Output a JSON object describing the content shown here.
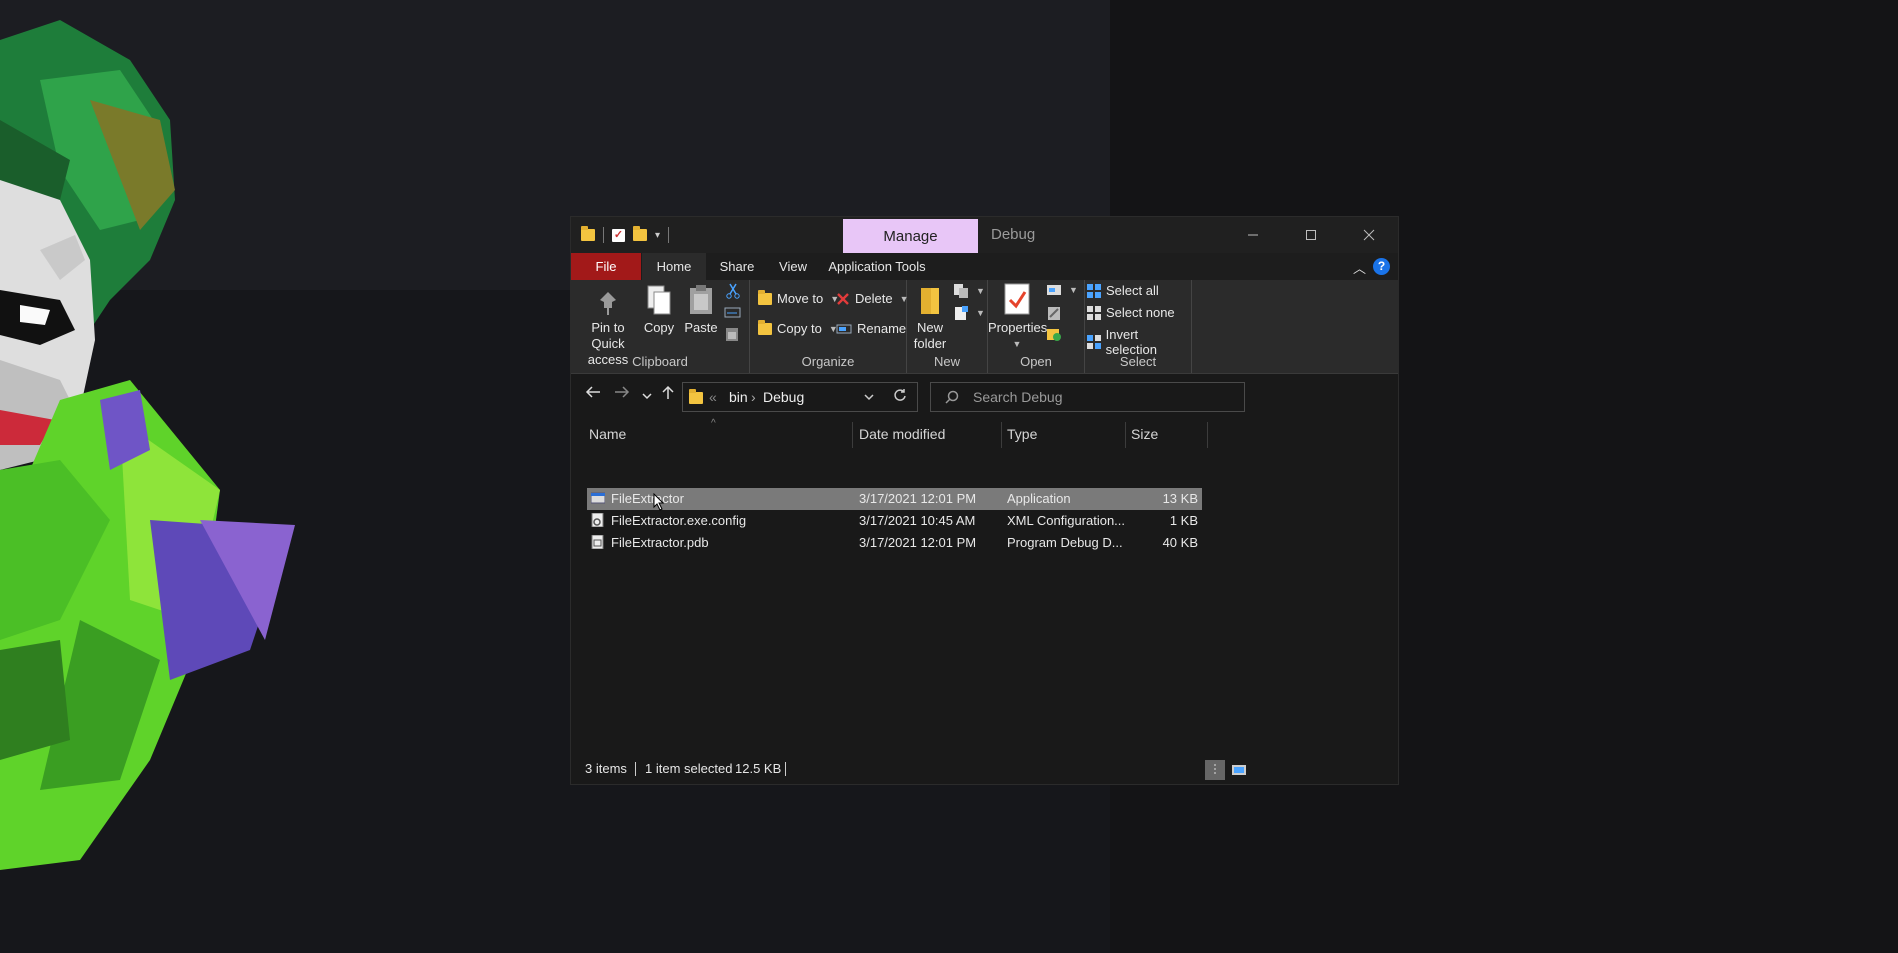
{
  "window": {
    "title": "Debug",
    "context_tab": "Manage",
    "context_color": "#e8c6f7"
  },
  "ribbon_tabs": [
    "File",
    "Home",
    "Share",
    "View",
    "Application Tools"
  ],
  "ribbon": {
    "clipboard": {
      "group": "Clipboard",
      "pin": "Pin to Quick access",
      "pin_l1": "Pin to Quick",
      "pin_l2": "access",
      "copy": "Copy",
      "paste": "Paste"
    },
    "organize": {
      "group": "Organize",
      "move_to": "Move to",
      "copy_to": "Copy to",
      "delete": "Delete",
      "rename": "Rename"
    },
    "new": {
      "group": "New",
      "new_folder_l1": "New",
      "new_folder_l2": "folder"
    },
    "open": {
      "group": "Open",
      "properties": "Properties"
    },
    "select": {
      "group": "Select",
      "select_all": "Select all",
      "select_none": "Select none",
      "invert": "Invert selection"
    }
  },
  "address": {
    "overflow": "«",
    "crumbs": [
      "bin",
      "Debug"
    ]
  },
  "search": {
    "placeholder": "Search Debug"
  },
  "columns": {
    "name": "Name",
    "date": "Date modified",
    "type": "Type",
    "size": "Size"
  },
  "files": [
    {
      "name": "FileExtractor",
      "date": "3/17/2021 12:01 PM",
      "type": "Application",
      "size": "13 KB",
      "icon": "application-icon",
      "selected": true
    },
    {
      "name": "FileExtractor.exe.config",
      "date": "3/17/2021 10:45 AM",
      "type": "XML Configuration...",
      "size": "1 KB",
      "icon": "config-file-icon",
      "selected": false
    },
    {
      "name": "FileExtractor.pdb",
      "date": "3/17/2021 12:01 PM",
      "type": "Program Debug D...",
      "size": "40 KB",
      "icon": "pdb-file-icon",
      "selected": false
    }
  ],
  "status": {
    "items": "3 items",
    "selected": "1 item selected",
    "size": "12.5 KB"
  },
  "colors": {
    "file_tab": "#a21919",
    "help": "#1a73e8",
    "selection": "#7a7a7a",
    "folder": "#f3c440"
  }
}
